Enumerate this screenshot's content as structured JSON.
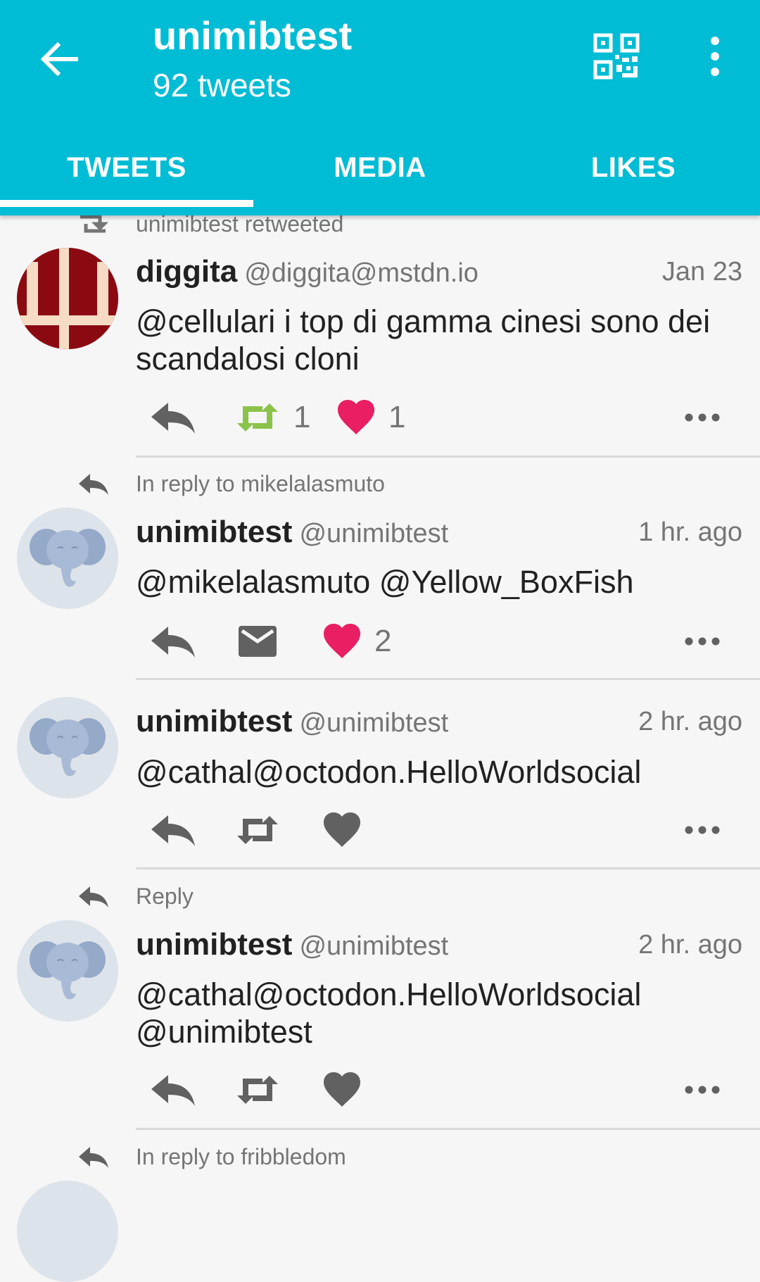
{
  "header": {
    "title": "unimibtest",
    "subtitle": "92 tweets",
    "tabs": [
      "TWEETS",
      "MEDIA",
      "LIKES"
    ],
    "active_tab": "TWEETS",
    "colors": {
      "primary": "#00bcd4",
      "fav": "#e91e63",
      "boost": "#8bc34a"
    }
  },
  "tweets": [
    {
      "context": "unimibtest retweeted",
      "name": "diggita",
      "handle": "@diggita@mstdn.io",
      "time": "Jan 23",
      "text": "@cellulari i top di gamma cinesi sono dei scandalosi cloni",
      "boost_count": "1",
      "fav_count": "1"
    },
    {
      "context": "In reply to mikelalasmuto",
      "name": "unimibtest",
      "handle": "@unimibtest",
      "time": "1 hr. ago",
      "text": "@mikelalasmuto @Yellow_BoxFish",
      "fav_count": "2"
    },
    {
      "name": "unimibtest",
      "handle": "@unimibtest",
      "time": "2 hr. ago",
      "text": "@cathal@octodon.HelloWorldsocial"
    },
    {
      "context": "Reply",
      "name": "unimibtest",
      "handle": "@unimibtest",
      "time": "2 hr. ago",
      "text": "@cathal@octodon.HelloWorldsocial @unimibtest"
    },
    {
      "context": "In reply to fribbledom"
    }
  ]
}
